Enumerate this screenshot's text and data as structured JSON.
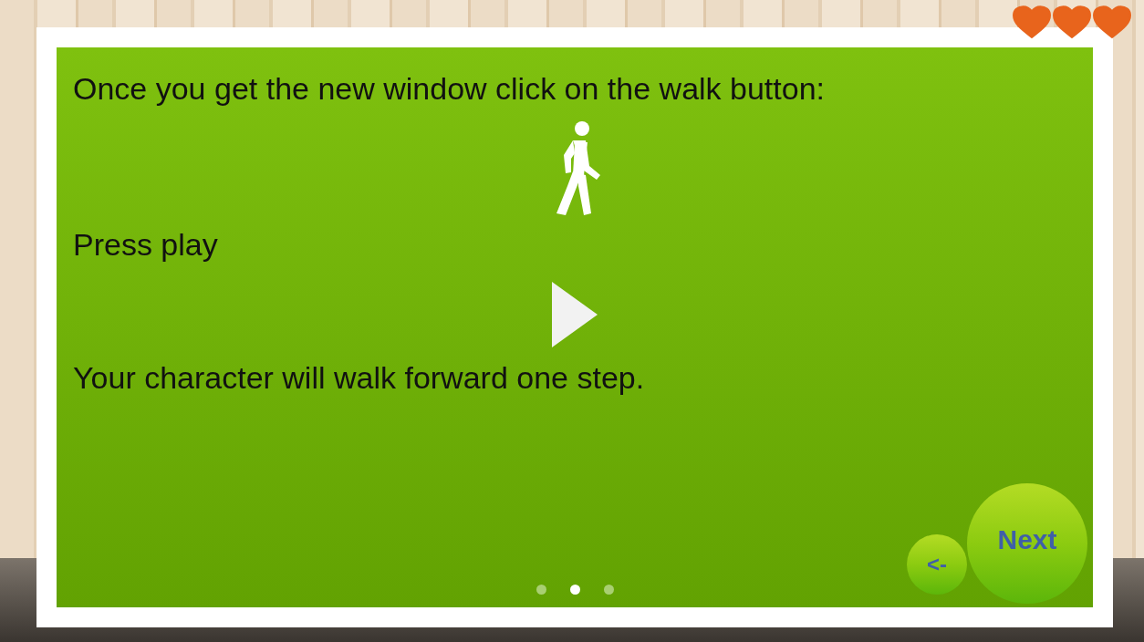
{
  "dialog": {
    "content": [
      {
        "kind": "text",
        "text": "Once you get the new window click on the walk button:"
      },
      {
        "kind": "walk-icon"
      },
      {
        "kind": "text",
        "text": "Press play"
      },
      {
        "kind": "play-icon"
      },
      {
        "kind": "text",
        "text": "Your character will walk forward one step."
      }
    ],
    "pages": [
      {
        "selected": false
      },
      {
        "selected": true
      },
      {
        "selected": false
      }
    ],
    "back_button": "<-",
    "next_button": "Next"
  },
  "lives": [
    {
      "filled": true
    },
    {
      "filled": true
    },
    {
      "filled": true
    }
  ]
}
